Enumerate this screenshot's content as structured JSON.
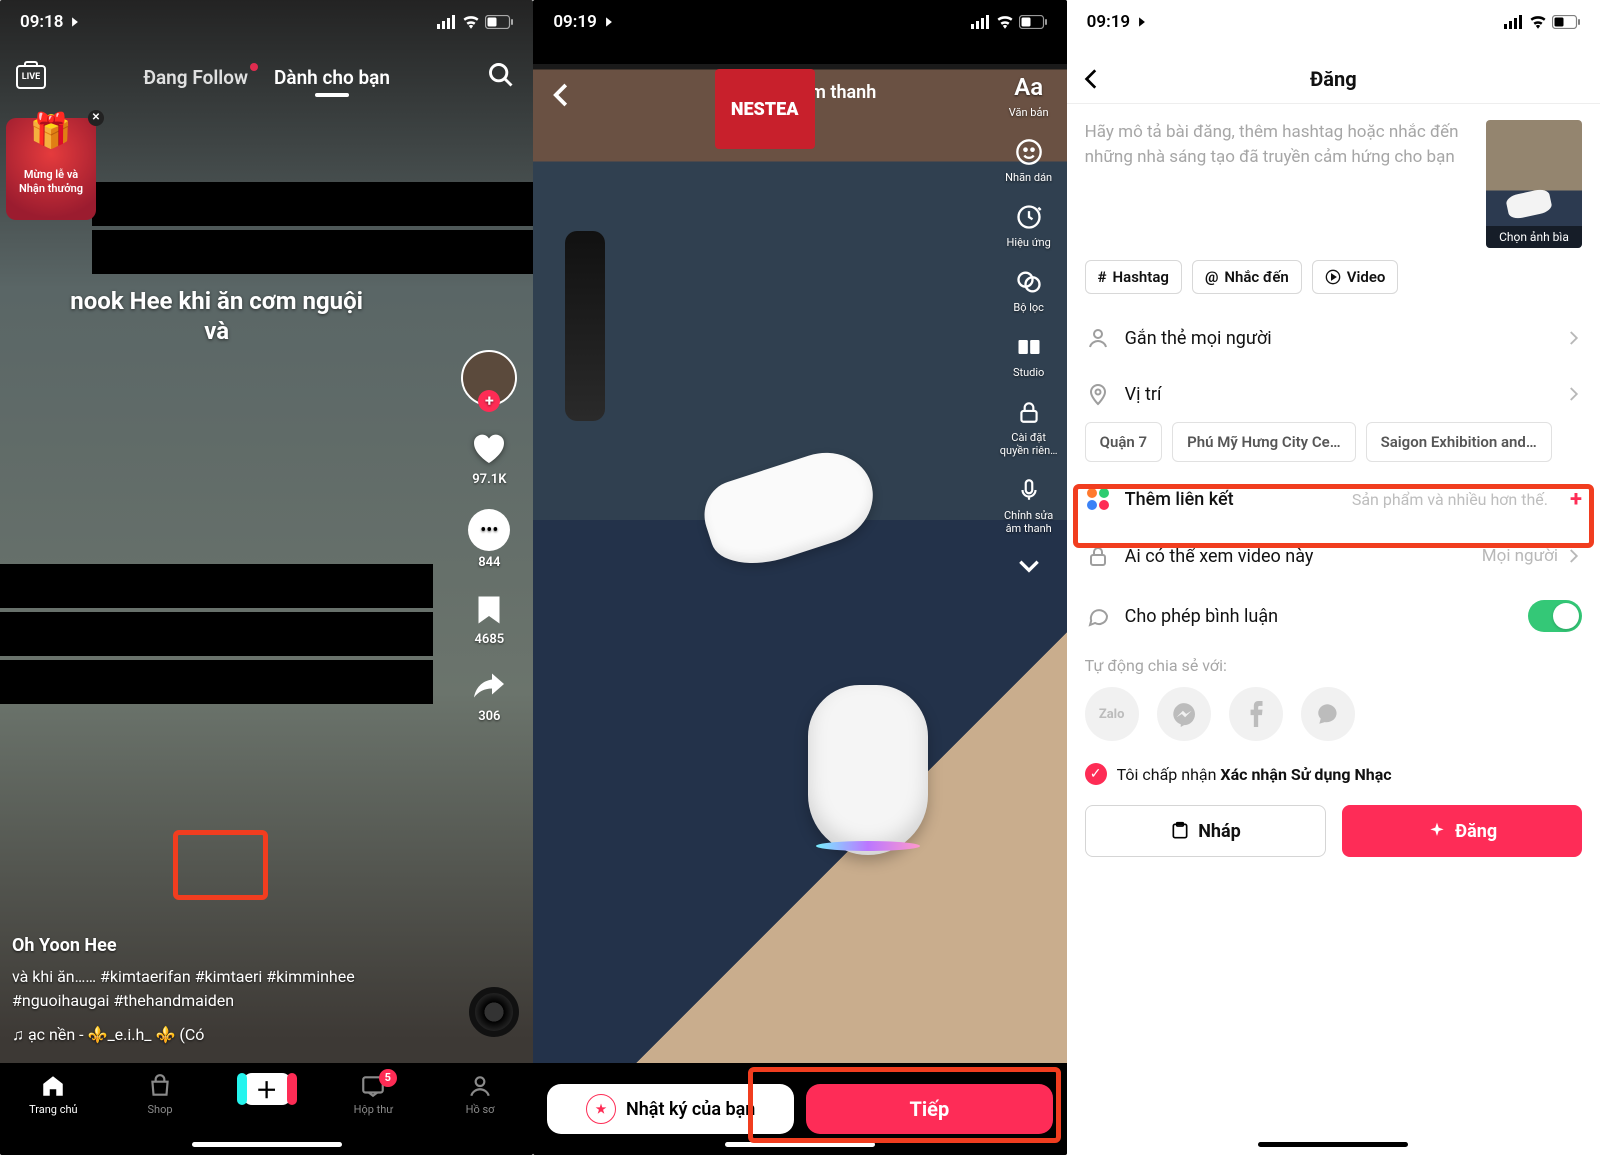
{
  "screen1": {
    "status": {
      "time": "09:18"
    },
    "tabs": {
      "follow": "Đang Follow",
      "foryou": "Dành cho bạn"
    },
    "live": "LIVE",
    "promo": {
      "line1": "Mừng lễ và",
      "line2": "Nhận thưởng"
    },
    "midtext1": "nook Hee khi ăn cơm nguội",
    "midtext2": "và",
    "counts": {
      "like": "97.1K",
      "comment": "844",
      "bookmark": "4685",
      "share": "306"
    },
    "author": "Oh Yoon Hee",
    "caption": "và khi ăn…… #kimtaerifan #kimtaeri #kimminhee #nguoihaugai #thehandmaiden",
    "sound": "♫ ạc nền - ⚜️_e.i.h_ ⚜️ (Có",
    "nav": {
      "home": "Trang chủ",
      "shop": "Shop",
      "inbox": "Hộp thư",
      "profile": "Hồ sơ",
      "badge": "5"
    }
  },
  "screen2": {
    "status": {
      "time": "09:19"
    },
    "addSound": "Thêm âm thanh",
    "nestea": "NESTEA",
    "tools": {
      "text": "Văn bản",
      "sticker": "Nhãn dán",
      "effect": "Hiệu ứng",
      "filter": "Bộ lọc",
      "studio": "Studio",
      "privacy": "Cài đặt quyền riên…",
      "audio": "Chỉnh sửa âm thanh"
    },
    "diary": "Nhật ký của bạn",
    "next": "Tiếp"
  },
  "screen3": {
    "status": {
      "time": "09:19"
    },
    "title": "Đăng",
    "placeholder": "Hãy mô tả bài đăng, thêm hashtag hoặc nhắc đến những nhà sáng tạo đã truyền cảm hứng cho bạn",
    "cover": "Chọn ảnh bìa",
    "chips": {
      "hashtag": "Hashtag",
      "mention": "Nhắc đến",
      "video": "Video"
    },
    "rows": {
      "tag": "Gắn thẻ mọi người",
      "location": "Vị trí",
      "link": "Thêm liên kết",
      "linkHint": "Sản phẩm và nhiều hơn thế.",
      "privacy": "Ai có thể xem video này",
      "privacyVal": "Mọi người",
      "comments": "Cho phép bình luận"
    },
    "locs": {
      "a": "Quận 7",
      "b": "Phú Mỹ Hưng City Ce…",
      "c": "Saigon Exhibition and…"
    },
    "share": {
      "label": "Tự động chia sẻ với:",
      "zalo": "Zalo"
    },
    "accept": {
      "pre": "Tôi chấp nhận ",
      "bold": "Xác nhận Sử dụng Nhạc"
    },
    "buttons": {
      "draft": "Nháp",
      "post": "Đăng"
    }
  }
}
